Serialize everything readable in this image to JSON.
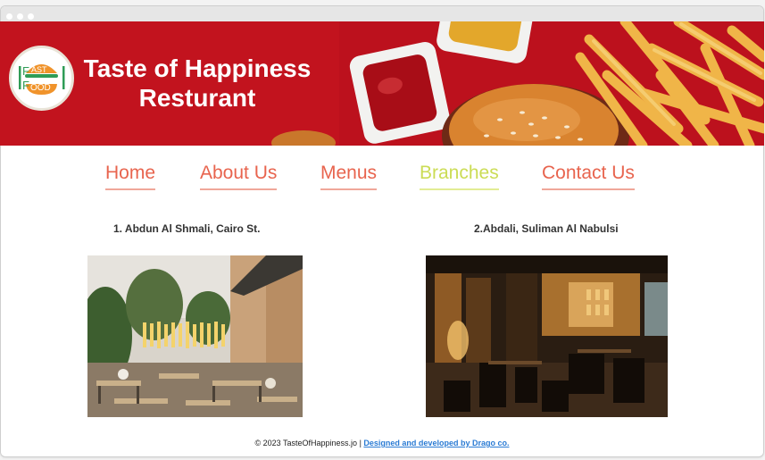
{
  "brand": {
    "title_line1": "Taste of Happiness",
    "title_line2": "Resturant",
    "logo_word_top": "AST",
    "logo_word_bottom": "OOD",
    "logo_letter_f": "F",
    "colors": {
      "banner_red": "#c4141f",
      "logo_orange": "#f0932b",
      "logo_green": "#2f9c56"
    }
  },
  "nav": {
    "items": [
      {
        "label": "Home",
        "active": false
      },
      {
        "label": "About Us",
        "active": false
      },
      {
        "label": "Menus",
        "active": false
      },
      {
        "label": "Branches",
        "active": true
      },
      {
        "label": "Contact Us",
        "active": false
      }
    ],
    "colors": {
      "default": "#e8644e",
      "active": "#cbdc55"
    }
  },
  "branches": [
    {
      "label": "1. Abdun Al Shmali, Cairo St.",
      "photo": "outdoor-terrace-photo"
    },
    {
      "label": "2.Abdali, Suliman Al Nabulsi",
      "photo": "indoor-dining-photo"
    }
  ],
  "footer": {
    "copyright": "© 2023 TasteOfHappiness.jo |",
    "credit_link": "Designed and developed by Drago co."
  }
}
